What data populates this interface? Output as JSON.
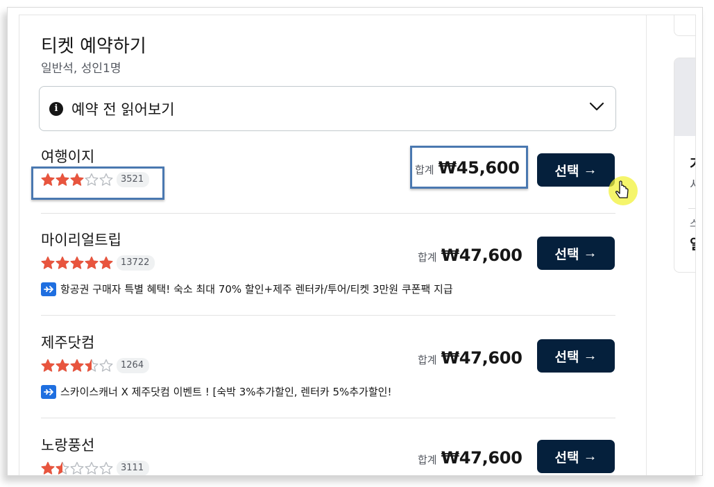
{
  "page": {
    "title": "티켓 예약하기",
    "subtitle": "일반석, 성인1명"
  },
  "notice": {
    "label": "예약 전 읽어보기",
    "icon": "info-icon",
    "chevron": "chevron-down-icon"
  },
  "offers": [
    {
      "vendor": "여행이지",
      "rating": 3,
      "review_count": "3521",
      "price_label": "합계",
      "price": "₩45,600",
      "button_label": "선택",
      "promo": ""
    },
    {
      "vendor": "마이리얼트립",
      "rating": 5,
      "review_count": "13722",
      "price_label": "합계",
      "price": "₩47,600",
      "button_label": "선택",
      "promo": "항공권 구매자 특별 혜택! 숙소 최대 70% 할인+제주 렌터카/투어/티켓 3만원 쿠폰팩 지급"
    },
    {
      "vendor": "제주닷컴",
      "rating": 3.5,
      "review_count": "1264",
      "price_label": "합계",
      "price": "₩47,600",
      "button_label": "선택",
      "promo": "스카이스캐너 X 제주닷컴 이벤트 ! [숙박 3%추가할인, 렌터카 5%추가할인!"
    },
    {
      "vendor": "노랑풍선",
      "rating": 1.5,
      "review_count": "3111",
      "price_label": "합계",
      "price": "₩47,600",
      "button_label": "선택",
      "promo": ""
    }
  ],
  "colors": {
    "star_filled": "#e8553e",
    "star_empty": "#b9bdc2",
    "button_bg": "#05203c",
    "promo_icon": "#1f6fe0",
    "highlight": "#4a78b0"
  },
  "sidebar": {
    "glyph_1": "가",
    "glyph_2": "서",
    "glyph_3": "스",
    "glyph_4": "일"
  }
}
